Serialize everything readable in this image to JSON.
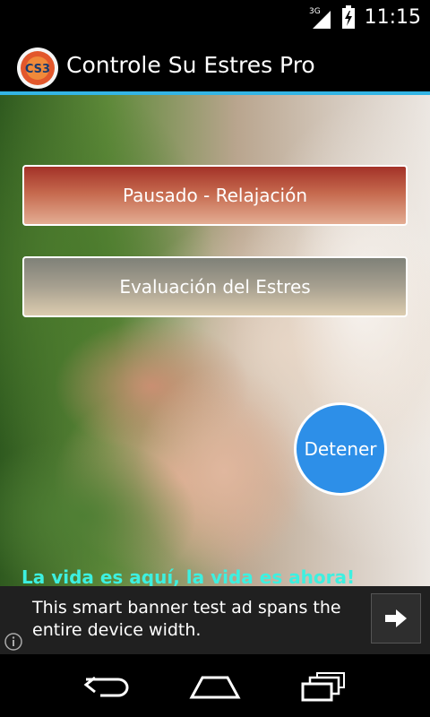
{
  "status_bar": {
    "network_label": "3G",
    "time": "11:15"
  },
  "app": {
    "title": "Controle Su Estres Pro",
    "logo_text": "CS3"
  },
  "buttons": {
    "relax_label": "Pausado - Relajación",
    "evaluation_label": "Evaluación del Estres",
    "stop_label": "Detener"
  },
  "tagline": "La vida es aquí, la vida es ahora!",
  "ad": {
    "text": "This smart banner test ad spans the entire device width."
  },
  "colors": {
    "accent": "#33b5e5",
    "stop_button": "#2d8fe8",
    "tagline": "#3df0e0"
  },
  "icons": {
    "network": "signal-3g-icon",
    "battery": "battery-charging-icon",
    "ad_arrow": "arrow-right-icon",
    "ad_info": "info-icon",
    "nav_back": "back-icon",
    "nav_home": "home-icon",
    "nav_recents": "recents-icon"
  }
}
